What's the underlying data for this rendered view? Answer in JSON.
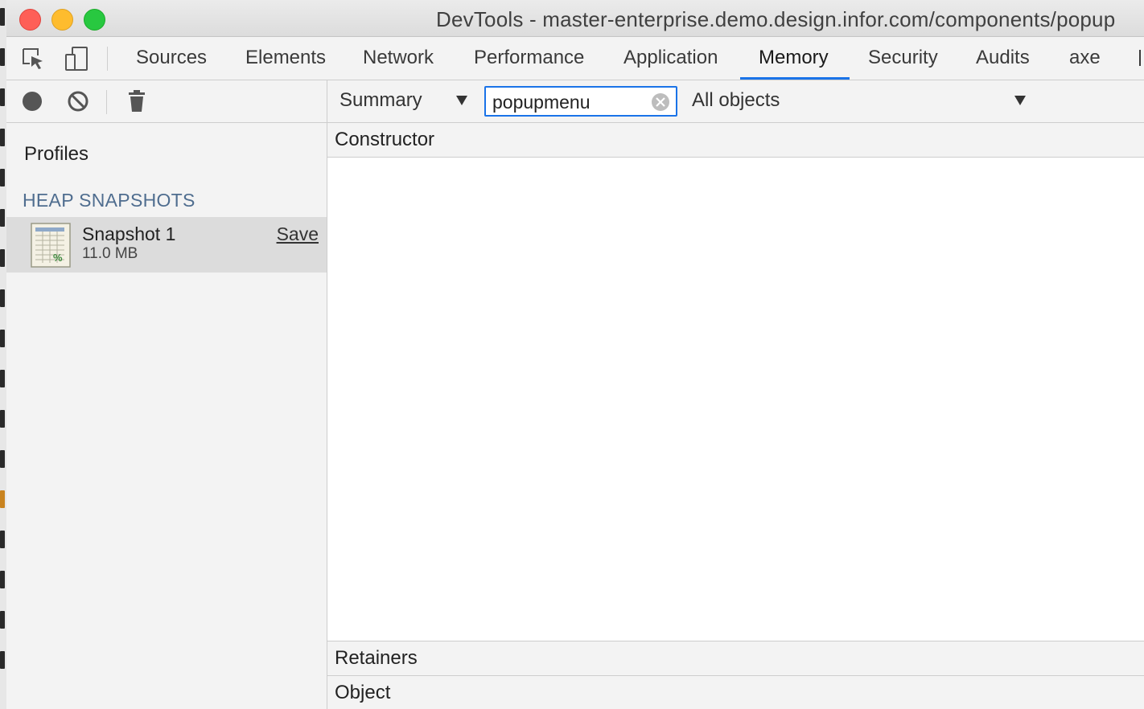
{
  "window": {
    "title": "DevTools - master-enterprise.demo.design.infor.com/components/popup"
  },
  "toolbar_icons": {
    "inspect": "element-picker-icon",
    "device": "device-toolbar-icon"
  },
  "tabs": [
    {
      "label": "Sources",
      "active": false
    },
    {
      "label": "Elements",
      "active": false
    },
    {
      "label": "Network",
      "active": false
    },
    {
      "label": "Performance",
      "active": false
    },
    {
      "label": "Application",
      "active": false
    },
    {
      "label": "Memory",
      "active": true
    },
    {
      "label": "Security",
      "active": false
    },
    {
      "label": "Audits",
      "active": false
    },
    {
      "label": "axe",
      "active": false
    }
  ],
  "sidebar": {
    "profiles_label": "Profiles",
    "section_label": "HEAP SNAPSHOTS",
    "snapshots": [
      {
        "name": "Snapshot 1",
        "size": "11.0 MB",
        "save_label": "Save"
      }
    ]
  },
  "main": {
    "view_select": "Summary",
    "filter": {
      "value": "popupmenu",
      "placeholder": "Class filter"
    },
    "objects_select": "All objects",
    "column_header": "Constructor",
    "retainers_label": "Retainers",
    "object_label": "Object"
  },
  "colors": {
    "accent": "#1a73e8",
    "close": "#fe5f57",
    "minimize": "#febc2e",
    "maximize": "#28c840",
    "section_label": "#4f6d8f"
  }
}
